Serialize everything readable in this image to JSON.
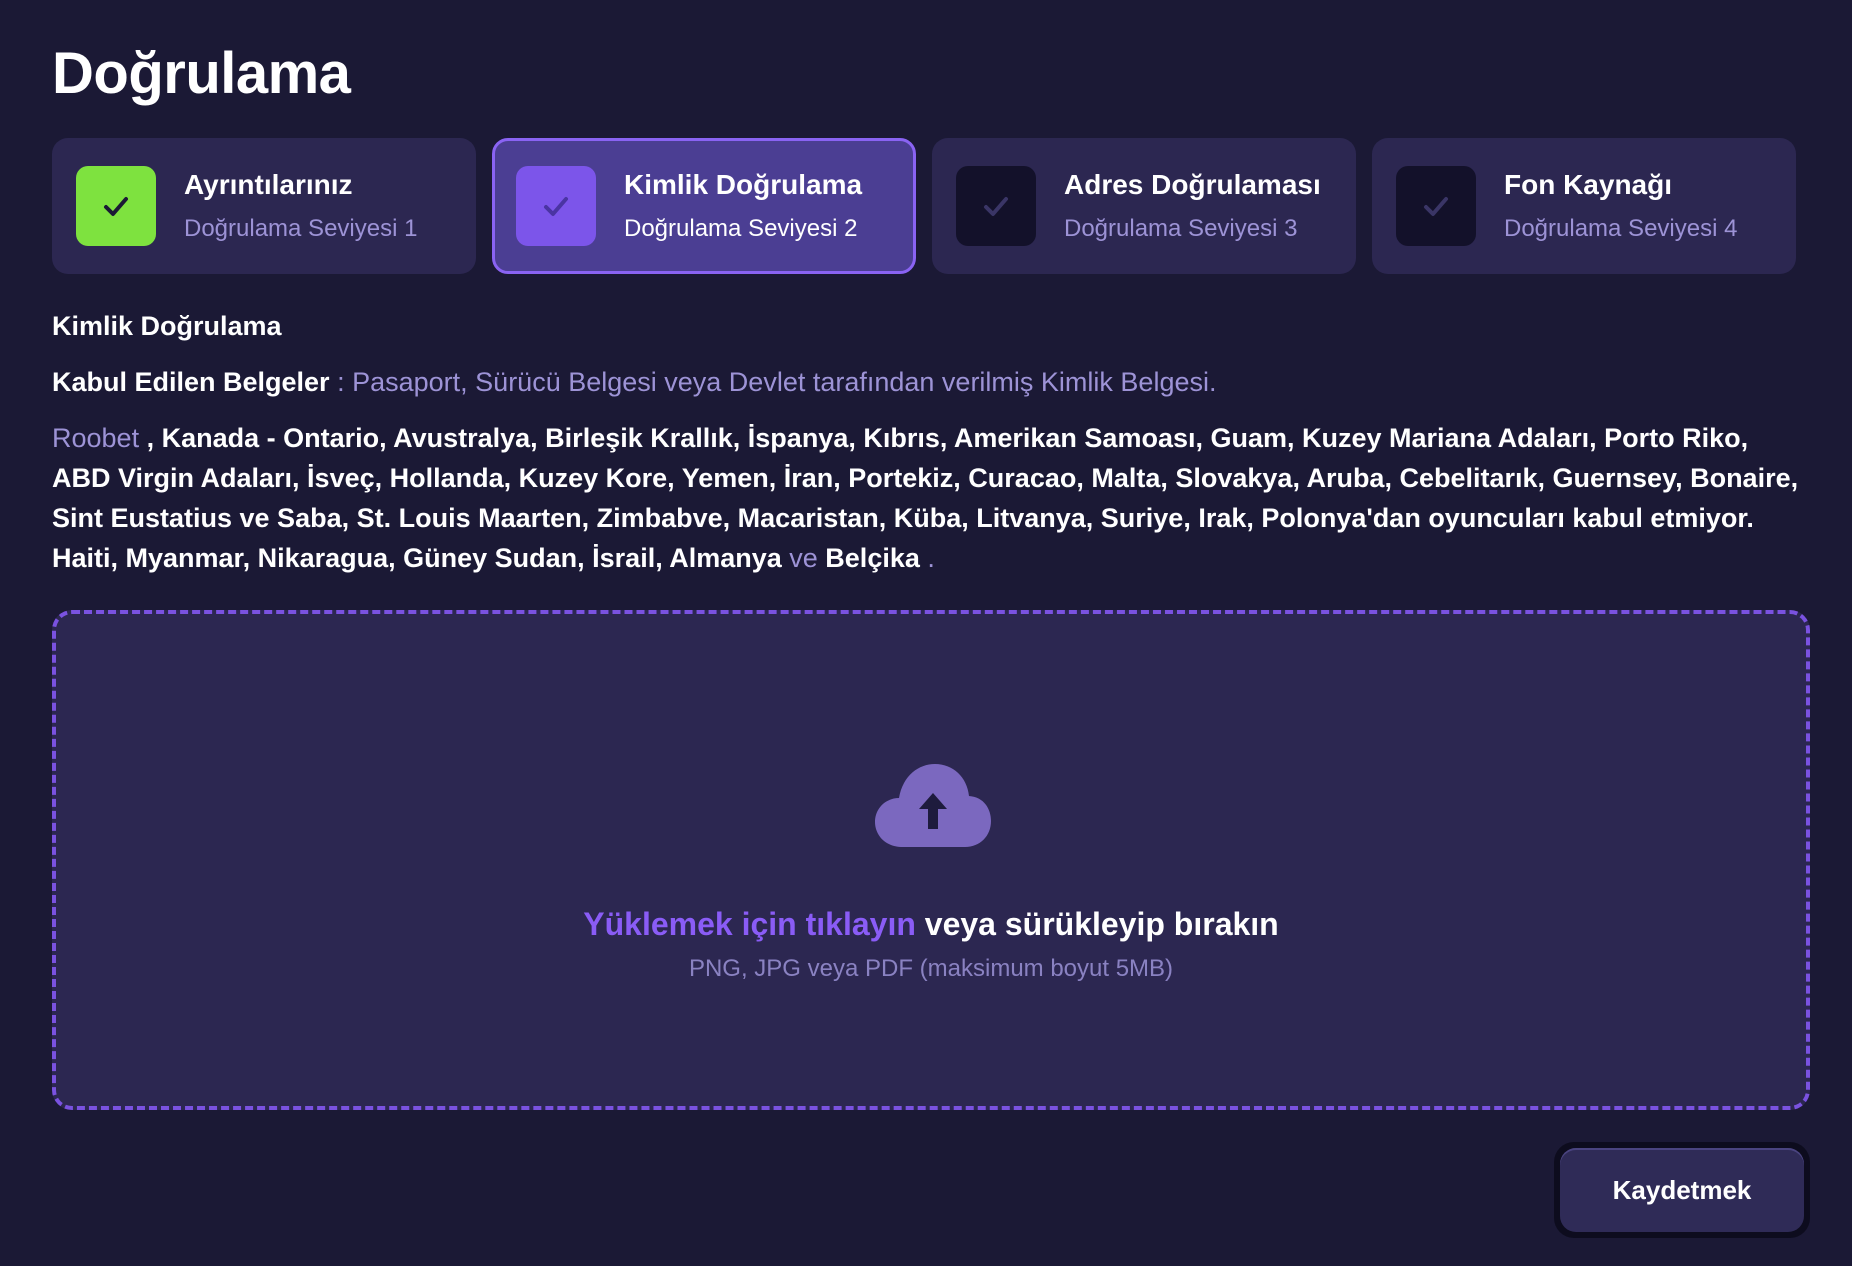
{
  "page_title": "Doğrulama",
  "steps": [
    {
      "title": "Ayrıntılarınız",
      "subtitle": "Doğrulama Seviyesi 1",
      "state": "completed"
    },
    {
      "title": "Kimlik Doğrulama",
      "subtitle": "Doğrulama Seviyesi 2",
      "state": "active"
    },
    {
      "title": "Adres Doğrulaması",
      "subtitle": "Doğrulama Seviyesi 3",
      "state": "pending"
    },
    {
      "title": "Fon Kaynağı",
      "subtitle": "Doğrulama Seviyesi 4",
      "state": "pending"
    }
  ],
  "section": {
    "title": "Kimlik Doğrulama",
    "accepted_label": "Kabul Edilen Belgeler",
    "accepted_separator": " : ",
    "accepted_value": "Pasaport, Sürücü Belgesi veya Devlet tarafından verilmiş Kimlik Belgesi.",
    "restriction_brand": "Roobet",
    "restriction_text": " , Kanada - Ontario, Avustralya, Birleşik Krallık, İspanya, Kıbrıs, Amerikan Samoası, Guam, Kuzey Mariana Adaları, Porto Riko, ABD Virgin Adaları, İsveç, Hollanda, Kuzey Kore, Yemen, İran, Portekiz, Curacao, Malta, Slovakya, Aruba, Cebelitarık, Guernsey, Bonaire, Sint Eustatius ve Saba, St. Louis Maarten, Zimbabve, Macaristan, Küba, Litvanya, Suriye, Irak, Polonya'dan oyuncuları kabul etmiyor. Haiti, Myanmar, Nikaragua, Güney Sudan, İsrail, Almanya",
    "restriction_conj": " ve ",
    "restriction_last": "Belçika",
    "restriction_end": " ."
  },
  "upload": {
    "link_text": "Yüklemek için tıklayın",
    "rest_text": " veya sürükleyip bırakın",
    "hint": "PNG, JPG veya PDF (maksimum boyut 5MB)",
    "icon": "cloud-upload-icon"
  },
  "save_label": "Kaydetmek",
  "colors": {
    "background": "#1b1935",
    "card": "#2c2751",
    "active_card": "#4b3e93",
    "accent": "#8a5cf6",
    "success": "#7ee23f",
    "muted_text": "#9d93d6"
  }
}
